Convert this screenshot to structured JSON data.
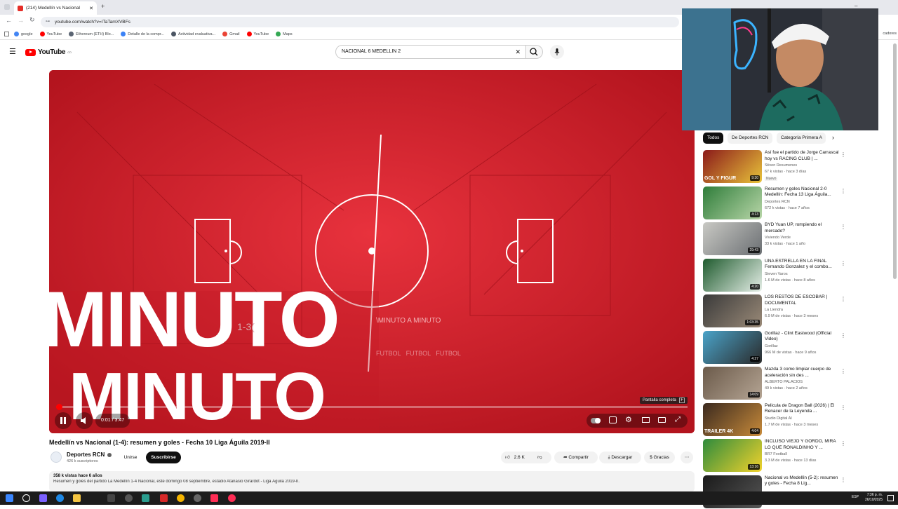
{
  "browser": {
    "tab_title": "(214) Medellín vs Nacional",
    "url": "youtube.com/watch?v=ITaTamXVBFs",
    "bookmarks": [
      {
        "label": "google",
        "color": "#4285f4"
      },
      {
        "label": "YouTube",
        "color": "#ff0000"
      },
      {
        "label": "Ethereum (ETH) Blo...",
        "color": "#5a6472"
      },
      {
        "label": "Detalle de la compr...",
        "color": "#3b82f6"
      },
      {
        "label": "Actividad evaluativa...",
        "color": "#4b5563"
      },
      {
        "label": "Gmail",
        "color": "#ea4335"
      },
      {
        "label": "YouTube",
        "color": "#ff0000"
      },
      {
        "label": "Maps",
        "color": "#34a853"
      }
    ],
    "bookmarks_overflow": "cadores"
  },
  "youtube": {
    "logo_text": "YouTube",
    "logo_region": "CO",
    "search_value": "NACIONAL 6 MEDELLIN 2"
  },
  "video": {
    "overlay_big_1": "MINUTO",
    "overlay_big_2": "MINUTO",
    "overlay_small_1": "\\MINUTO A MINUTO",
    "overlay_small_2": "FUTBOL   FUTBOL   FUTBOL",
    "overlay_score": "1-3(",
    "current_time": "0:01",
    "duration": "3:47",
    "time_separator": "/",
    "progress_fraction": 0.005,
    "fullscreen_tooltip": "Pantalla completa",
    "fullscreen_key": "F"
  },
  "details": {
    "title": "Medellín vs Nacional (1-4): resumen y goles - Fecha 10 Liga Águila 2019-II",
    "channel": "Deportes RCN",
    "subscribers": "426 k suscriptores",
    "join_label": "Unirse",
    "subscribe_label": "Suscribirse",
    "likes": "2.6 K",
    "share_label": "Compartir",
    "download_label": "Descargar",
    "thanks_label": "Gracias",
    "views_line": "358 k vistas  hace 6 años",
    "description": "Resumen y goles del partido La Medellín 1-4 Nacional, este domingo 08 septiembre, estadio Atanasio Girardot - Liga Águila 2019-II."
  },
  "sidebar": {
    "chips": [
      "Todos",
      "De Deportes RCN",
      "Categoría Primera A"
    ],
    "recommendations": [
      {
        "title": "Así fue el partido de Jorge Carrascal hoy vs RACING CLUB | ...",
        "channel": "Stiven Resumenes",
        "meta": "67 k vistas · hace 3 días",
        "badge": "Nuevo",
        "duration": "9:30",
        "thumb_text": "GOL Y FIGUR",
        "c1": "#8b1a1a",
        "c2": "#e8c33a"
      },
      {
        "title": "Resumen y goles Nacional 2-0 Medellín: Fecha 13 Liga Águila...",
        "channel": "Deportes RCN",
        "meta": "672 k vistas · hace 7 años",
        "badge": "",
        "duration": "4:13",
        "thumb_text": "",
        "c1": "#2f7d3a",
        "c2": "#b8d6a8"
      },
      {
        "title": "BYD Yuan UP, rompiendo el mercado?",
        "channel": "Viviendo Verde",
        "meta": "33 k vistas · hace 1 año",
        "badge": "",
        "duration": "29:43",
        "thumb_text": "",
        "c1": "#c9c9c4",
        "c2": "#6b6f73"
      },
      {
        "title": "UNA ESTRELLA EN LA FINAL Fernando Gonzalez y el combo...",
        "channel": "Steven Varos",
        "meta": "1.6 M de vistas · hace 8 años",
        "badge": "",
        "duration": "4:20",
        "thumb_text": "",
        "c1": "#1f5b2e",
        "c2": "#e6efe8"
      },
      {
        "title": "LOS RESTOS DE ESCOBAR | DOCUMENTAL",
        "channel": "La Liendra",
        "meta": "6.9 M de vistas · hace 3 meses",
        "badge": "",
        "duration": "1:03:35",
        "thumb_text": "",
        "c1": "#3a3a3a",
        "c2": "#9a8a78"
      },
      {
        "title": "Gorillaz - Clint Eastwood (Official Video)",
        "channel": "Gorillaz",
        "meta": "966 M de vistas · hace 9 años",
        "badge": "",
        "duration": "4:27",
        "thumb_text": "",
        "c1": "#4aa3c9",
        "c2": "#2a2a2a"
      },
      {
        "title": "Mazda 3 como limpiar cuerpo de aceleración sin des ...",
        "channel": "ALBERTO PALACIOS",
        "meta": "49 k vistas · hace 2 años",
        "badge": "",
        "duration": "14:09",
        "thumb_text": "",
        "c1": "#6b5a4a",
        "c2": "#b5a594"
      },
      {
        "title": "Pelicula de Dragon Ball (2026) | El Renacer de la Leyenda ...",
        "channel": "Studio Digital AI",
        "meta": "1.7 M de vistas · hace 3 meses",
        "badge": "",
        "duration": "4:04",
        "thumb_text": "TRAILER 4K",
        "c1": "#3b2a1f",
        "c2": "#c78a3a"
      },
      {
        "title": "INCLUSO VIEJO Y GORDO, MIRA LO QUE RONALDINHO Y ...",
        "channel": "BR7 Football",
        "meta": "3.3 M de vistas · hace 13 días",
        "badge": "",
        "duration": "13:16",
        "thumb_text": "",
        "c1": "#2e8b3d",
        "c2": "#f1d22c"
      },
      {
        "title": "Nacional vs Medellín (5-2): resumen y goles - Fecha 8 Lig...",
        "channel": "",
        "meta": "",
        "badge": "",
        "duration": "",
        "thumb_text": "",
        "c1": "#1a1a1a",
        "c2": "#555"
      }
    ]
  },
  "taskbar": {
    "time": "7:36 p. m.",
    "date": "26/10/2025",
    "lang": "ESP"
  }
}
